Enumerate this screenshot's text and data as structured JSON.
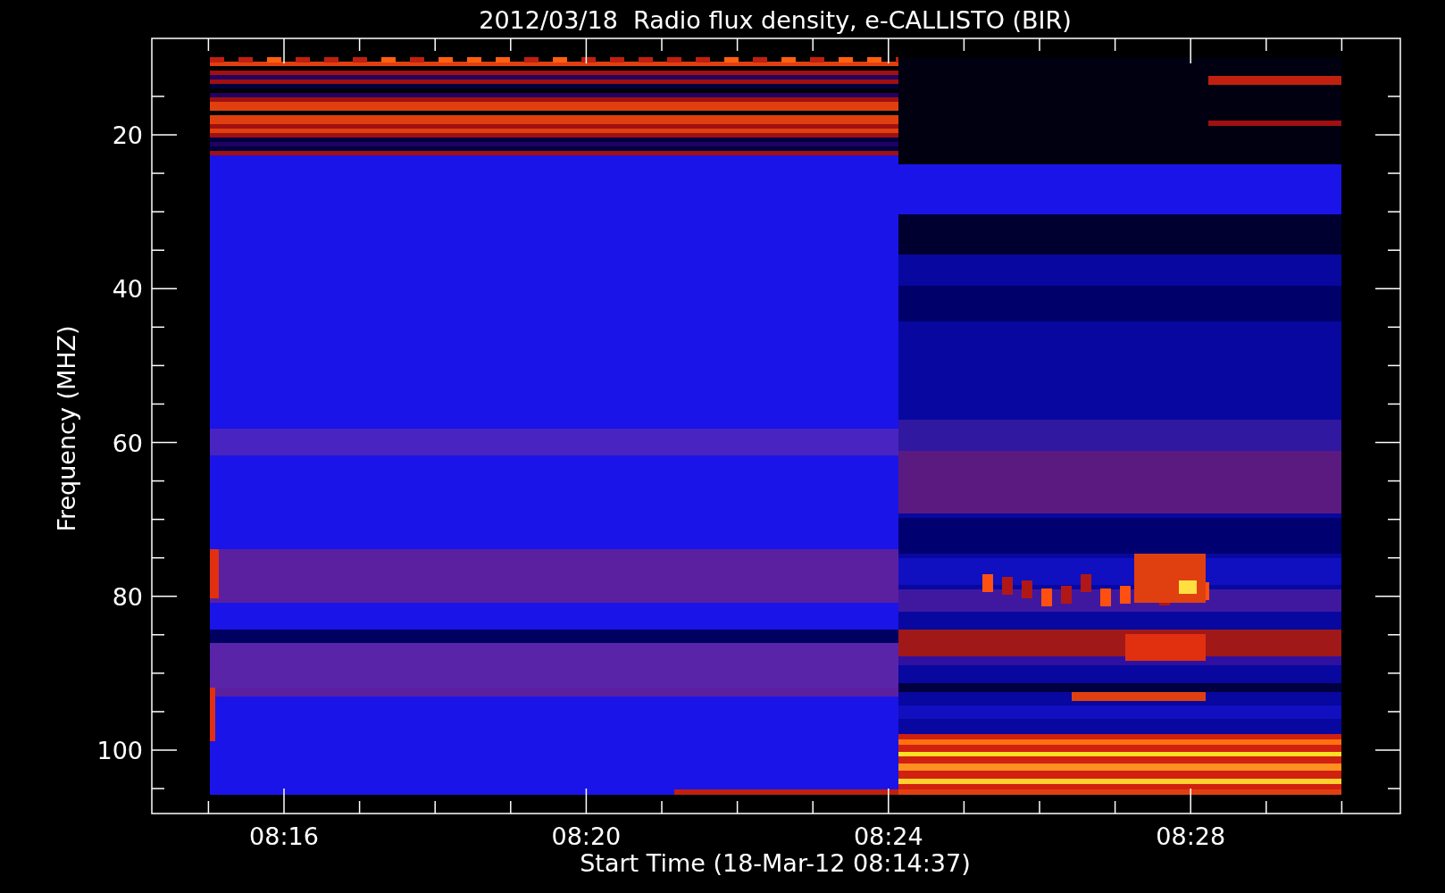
{
  "chart": {
    "title": "2012/03/18  Radio flux density, e-CALLISTO (BIR)",
    "ylabel": "Frequency (MHZ)",
    "xlabel": "Start Time (18-Mar-12 08:14:37)",
    "y_tick_labels": [
      "20",
      "40",
      "60",
      "80",
      "100"
    ],
    "x_tick_labels": [
      "08:16",
      "08:20",
      "08:24",
      "08:28"
    ]
  }
}
